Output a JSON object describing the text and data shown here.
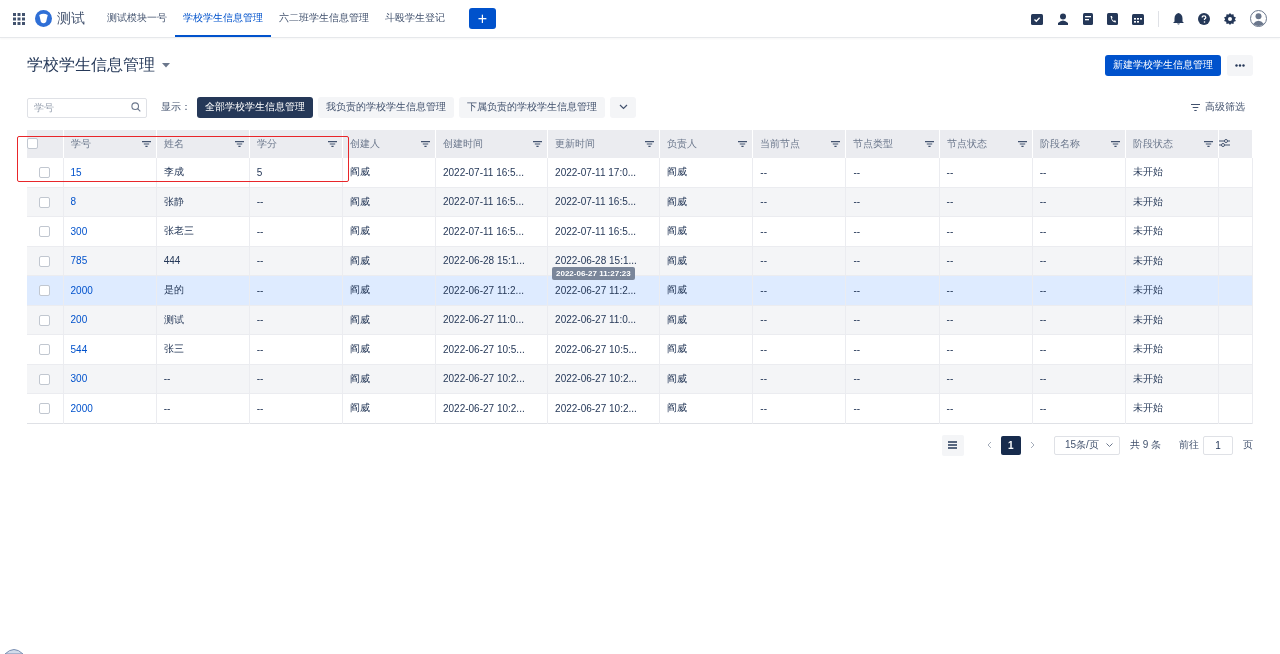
{
  "topbar": {
    "app_name": "测试",
    "tabs": [
      {
        "label": "测试模块一号",
        "selected": false
      },
      {
        "label": "学校学生信息管理",
        "selected": true
      },
      {
        "label": "六二班学生信息管理",
        "selected": false
      },
      {
        "label": "斗殴学生登记",
        "selected": false
      }
    ],
    "add_button": "+"
  },
  "page": {
    "title": "学校学生信息管理",
    "new_button": "新建学校学生信息管理"
  },
  "filters": {
    "search": {
      "placeholder": "学号"
    },
    "show_label": "显示：",
    "views": [
      {
        "label": "全部学校学生信息管理",
        "selected": true
      },
      {
        "label": "我负责的学校学生信息管理",
        "selected": false
      },
      {
        "label": "下属负责的学校学生信息管理",
        "selected": false
      }
    ],
    "advanced_filter": "高级筛选"
  },
  "table": {
    "header_checked": false,
    "columns": [
      {
        "label": "学号",
        "kind": "link"
      },
      {
        "label": "姓名",
        "kind": "text"
      },
      {
        "label": "学分",
        "kind": "text"
      },
      {
        "label": "创建人",
        "kind": "text"
      },
      {
        "label": "创建时间",
        "kind": "time"
      },
      {
        "label": "更新时间",
        "kind": "time"
      },
      {
        "label": "负责人",
        "kind": "text"
      },
      {
        "label": "当前节点",
        "kind": "text"
      },
      {
        "label": "节点类型",
        "kind": "text"
      },
      {
        "label": "节点状态",
        "kind": "text"
      },
      {
        "label": "阶段名称",
        "kind": "text"
      },
      {
        "label": "阶段状态",
        "kind": "text"
      }
    ],
    "rows": [
      {
        "checked": false,
        "highlighted": false,
        "cells": [
          "15",
          "李成",
          "5",
          "阎威",
          "2022-07-11 16:5...",
          "2022-07-11 17:0...",
          "阎威",
          "--",
          "--",
          "--",
          "--",
          "未开始"
        ]
      },
      {
        "checked": false,
        "highlighted": false,
        "cells": [
          "8",
          "张静",
          "--",
          "阎威",
          "2022-07-11 16:5...",
          "2022-07-11 16:5...",
          "阎威",
          "--",
          "--",
          "--",
          "--",
          "未开始"
        ]
      },
      {
        "checked": false,
        "highlighted": false,
        "cells": [
          "300",
          "张老三",
          "--",
          "阎威",
          "2022-07-11 16:5...",
          "2022-07-11 16:5...",
          "阎威",
          "--",
          "--",
          "--",
          "--",
          "未开始"
        ]
      },
      {
        "checked": false,
        "highlighted": false,
        "cells": [
          "785",
          "444",
          "--",
          "阎威",
          "2022-06-28 15:1...",
          "2022-06-28 15:1...",
          "阎威",
          "--",
          "--",
          "--",
          "--",
          "未开始"
        ]
      },
      {
        "checked": false,
        "highlighted": true,
        "cells": [
          "2000",
          "是的",
          "--",
          "阎威",
          "2022-06-27 11:2...",
          "2022-06-27 11:2...",
          "阎威",
          "--",
          "--",
          "--",
          "--",
          "未开始"
        ]
      },
      {
        "checked": false,
        "highlighted": false,
        "cells": [
          "200",
          "测试",
          "--",
          "阎威",
          "2022-06-27 11:0...",
          "2022-06-27 11:0...",
          "阎威",
          "--",
          "--",
          "--",
          "--",
          "未开始"
        ]
      },
      {
        "checked": false,
        "highlighted": false,
        "cells": [
          "544",
          "张三",
          "--",
          "阎威",
          "2022-06-27 10:5...",
          "2022-06-27 10:5...",
          "阎威",
          "--",
          "--",
          "--",
          "--",
          "未开始"
        ]
      },
      {
        "checked": false,
        "highlighted": false,
        "cells": [
          "300",
          "--",
          "--",
          "阎威",
          "2022-06-27 10:2...",
          "2022-06-27 10:2...",
          "阎威",
          "--",
          "--",
          "--",
          "--",
          "未开始"
        ]
      },
      {
        "checked": false,
        "highlighted": false,
        "cells": [
          "2000",
          "--",
          "--",
          "阎威",
          "2022-06-27 10:2...",
          "2022-06-27 10:2...",
          "阎威",
          "--",
          "--",
          "--",
          "--",
          "未开始"
        ]
      }
    ],
    "tooltip": "2022-06-27 11:27:23"
  },
  "pagination": {
    "pages": [
      {
        "label": "1",
        "selected": true
      }
    ],
    "page_size": "15条/页",
    "total": "共 9 条",
    "goto_label": "前往",
    "goto_value": "1",
    "page_suffix": "页"
  }
}
